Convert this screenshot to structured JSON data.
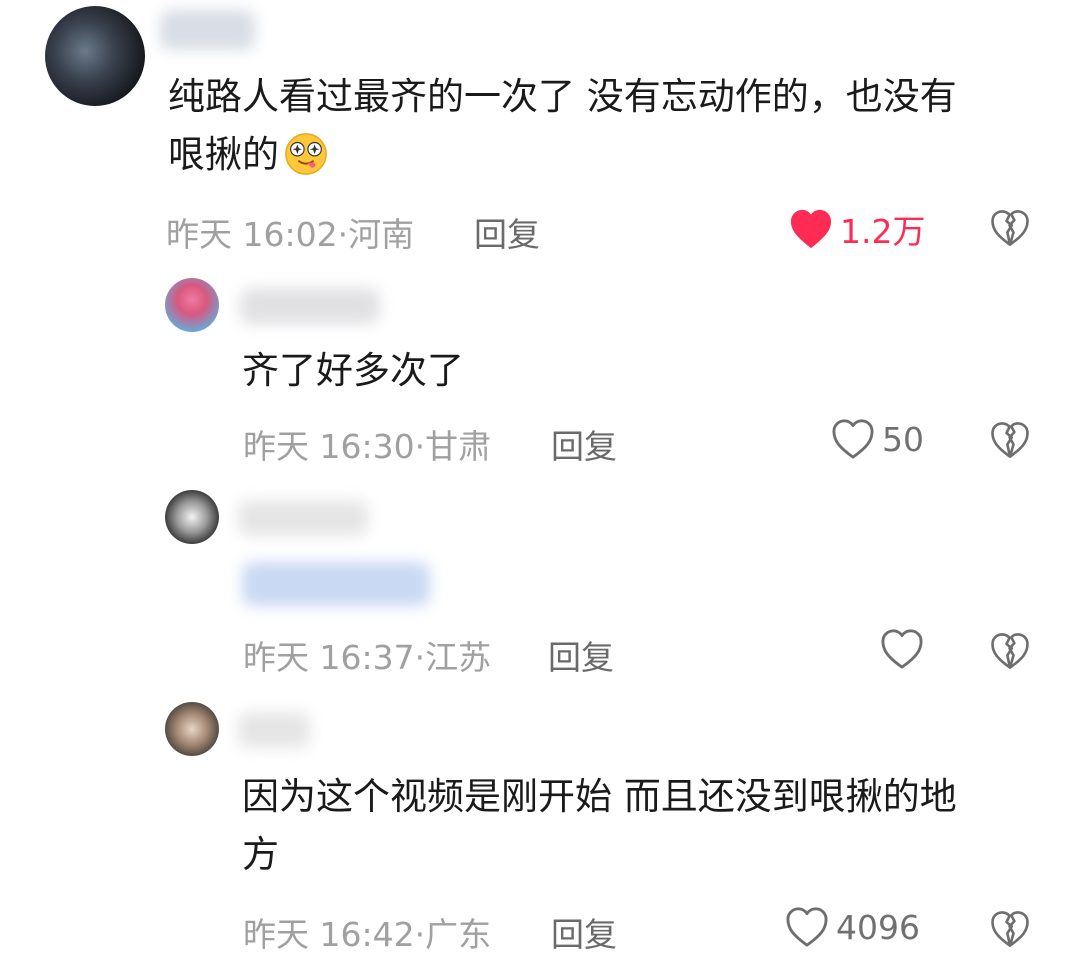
{
  "comments": [
    {
      "text": "纯路人看过最齐的一次了 没有忘动作的，也没有\n哏揪的",
      "emoji": "star-eyes-tongue-emoji",
      "time": "昨天 16:02",
      "location": "河南",
      "reply_label": "回复",
      "likes": "1.2万",
      "liked": true
    },
    {
      "text": "齐了好多次了",
      "time": "昨天 16:30",
      "location": "甘肃",
      "reply_label": "回复",
      "likes": "50",
      "liked": false
    },
    {
      "text": "",
      "time": "昨天 16:37",
      "location": "江苏",
      "reply_label": "回复",
      "likes": "",
      "liked": false
    },
    {
      "text": "因为这个视频是刚开始 而且还没到哏揪的地\n方",
      "time": "昨天 16:42",
      "location": "广东",
      "reply_label": "回复",
      "likes": "4096",
      "liked": false
    }
  ],
  "colors": {
    "like_active": "#fe2c55",
    "meta_text": "#a0a0a0",
    "reply_text": "#6a6a6a",
    "icon_stroke": "#6e6e6e"
  },
  "icons": {
    "like": "heart-icon",
    "dislike": "broken-heart-icon"
  }
}
